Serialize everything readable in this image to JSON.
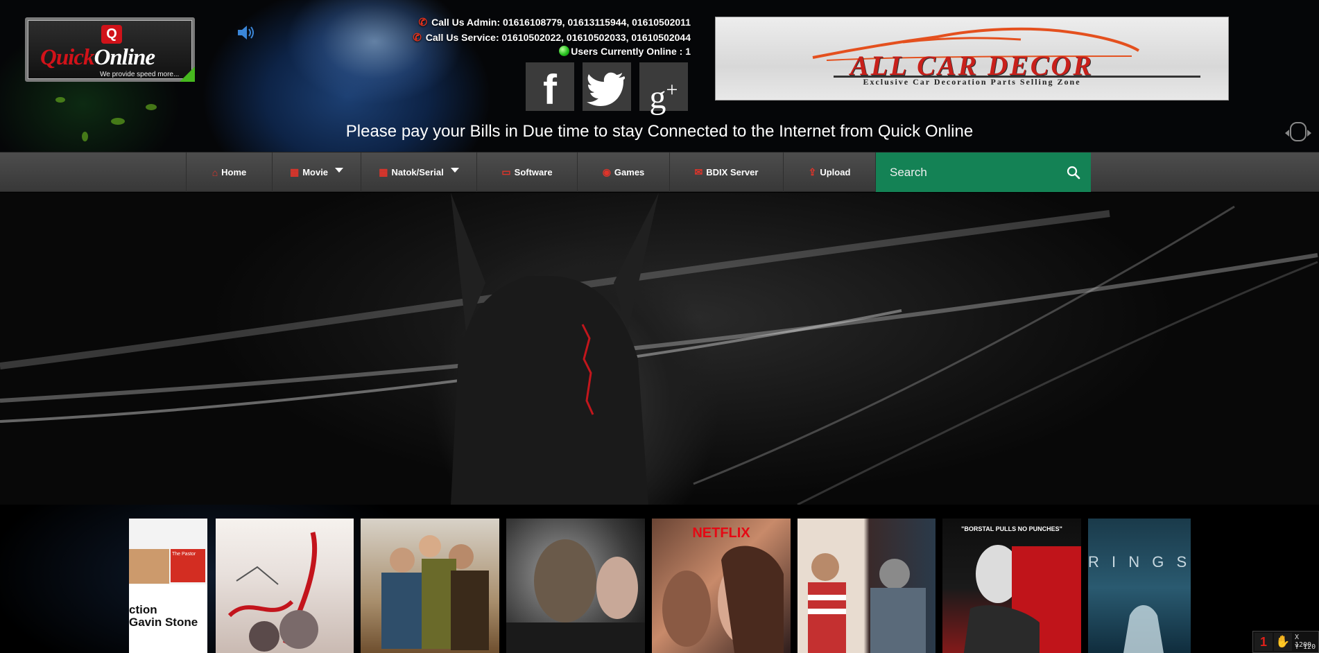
{
  "header": {
    "logo": {
      "badge": "Q",
      "brand_part1": "Quick",
      "brand_part2": "Online",
      "tagline": "We provide speed more..."
    },
    "contact": {
      "admin": "Call Us Admin: 01616108779, 01613115944, 01610502011",
      "service": "Call Us Service: 01610502022, 01610502033, 01610502044",
      "online": "Users Currently Online : 1"
    },
    "social": [
      {
        "name": "facebook",
        "glyph": "f"
      },
      {
        "name": "twitter",
        "icon": "twitter-bird-icon"
      },
      {
        "name": "google-plus",
        "glyph": "g",
        "suffix": "+"
      }
    ],
    "ad": {
      "title": "ALL CAR DECOR",
      "subtitle": "Exclusive Car Decoration Parts Selling Zone"
    },
    "marquee": "Please pay your Bills in Due time to stay Connected to the Internet from Quick Online"
  },
  "nav": {
    "items": [
      {
        "label": "Home",
        "icon": "home-icon",
        "glyph": "⌂",
        "dropdown": false
      },
      {
        "label": "Movie",
        "icon": "film-icon",
        "glyph": "▦",
        "dropdown": true
      },
      {
        "label": "Natok/Serial",
        "icon": "film-icon",
        "glyph": "▦",
        "dropdown": true
      },
      {
        "label": "Software",
        "icon": "monitor-icon",
        "glyph": "▭",
        "dropdown": false
      },
      {
        "label": "Games",
        "icon": "gamepad-icon",
        "glyph": "◉",
        "dropdown": false
      },
      {
        "label": "BDIX Server",
        "icon": "mail-icon",
        "glyph": "✉",
        "dropdown": false
      },
      {
        "label": "Upload",
        "icon": "upload-icon",
        "glyph": "⇪",
        "dropdown": false
      }
    ],
    "search_placeholder": "Search"
  },
  "posters": [
    {
      "id": "poster-1",
      "texts": [
        "ction",
        "Gavin Stone",
        "The Pastor"
      ]
    },
    {
      "id": "poster-2",
      "texts": []
    },
    {
      "id": "poster-3",
      "texts": []
    },
    {
      "id": "poster-4",
      "texts": []
    },
    {
      "id": "poster-5",
      "texts": [
        "NETFLIX"
      ]
    },
    {
      "id": "poster-6",
      "texts": []
    },
    {
      "id": "poster-7",
      "texts": [
        "\"BORSTAL PULLS NO PUNCHES\""
      ]
    },
    {
      "id": "poster-8",
      "texts": [
        "R I N G S"
      ]
    }
  ],
  "corner_widget": {
    "number": "1",
    "x_label": "X 1200",
    "y_label": "Y 120"
  },
  "colors": {
    "accent_red": "#e0342a",
    "search_green": "#148255",
    "nav_bg": "#404040"
  }
}
